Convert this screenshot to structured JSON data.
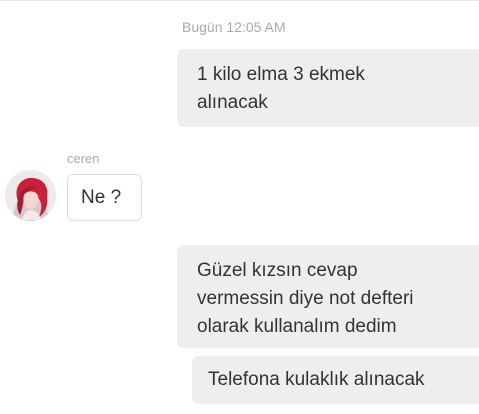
{
  "chat": {
    "timestamp": "Bugün 12:05 AM",
    "sender_name": "ceren",
    "messages": [
      {
        "direction": "outgoing",
        "lines": [
          "1 kilo elma 3 ekmek",
          "alınacak"
        ]
      },
      {
        "direction": "incoming",
        "lines": [
          "Ne ?"
        ]
      },
      {
        "direction": "outgoing",
        "lines": [
          "Güzel kızsın cevap",
          "vermessin diye not defteri",
          "olarak kullanalım dedim"
        ]
      },
      {
        "direction": "outgoing",
        "lines": [
          "Telefona kulaklık alınacak"
        ]
      }
    ]
  },
  "colors": {
    "outgoing_bubble": "#eeeeee",
    "incoming_bubble": "#ffffff",
    "meta_text": "#a9a9a9",
    "message_text": "#333333"
  },
  "icons": {
    "avatar": "user-avatar-photo"
  }
}
